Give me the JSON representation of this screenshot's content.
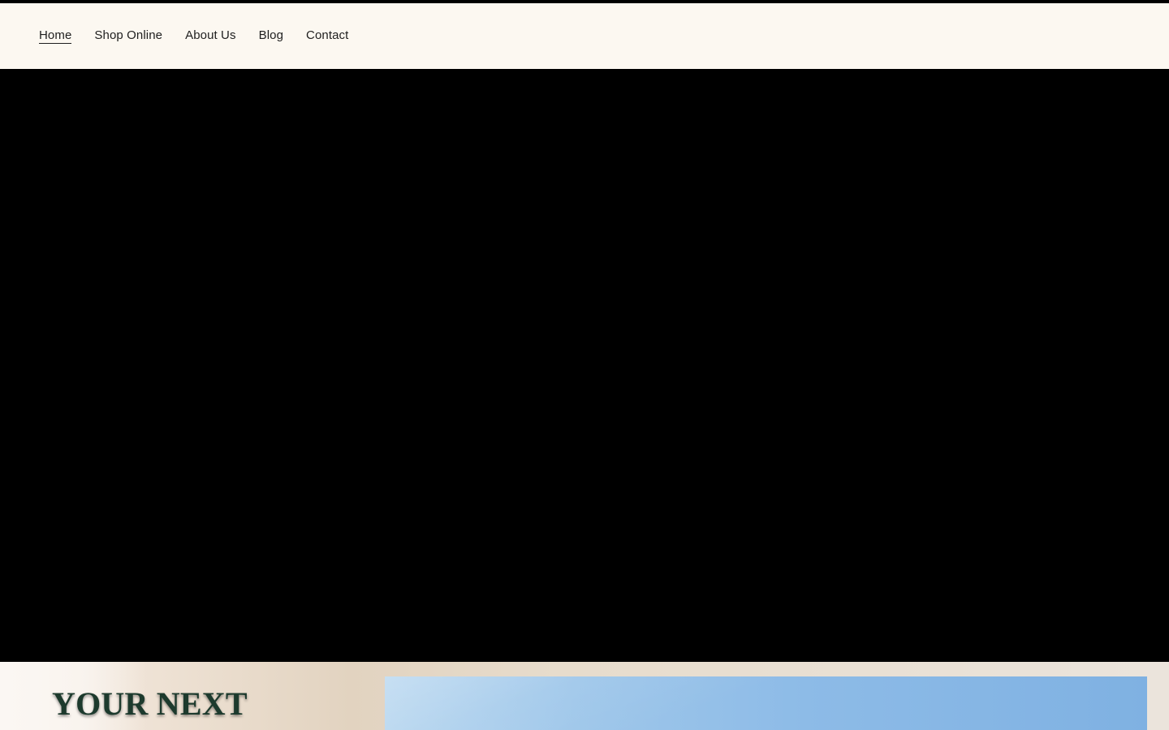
{
  "nav": {
    "items": [
      {
        "label": "Home",
        "active": true
      },
      {
        "label": "Shop Online",
        "active": false
      },
      {
        "label": "About Us",
        "active": false
      },
      {
        "label": "Blog",
        "active": false
      },
      {
        "label": "Contact",
        "active": false
      }
    ]
  },
  "feature": {
    "title": "YOUR NEXT"
  },
  "colors": {
    "header_background": "#fcf8f1",
    "nav_text": "#1e1e1e",
    "hero_background": "#000000",
    "feature_title": "#1d3a2d",
    "feature_image_sky": "#8dbbe7"
  }
}
